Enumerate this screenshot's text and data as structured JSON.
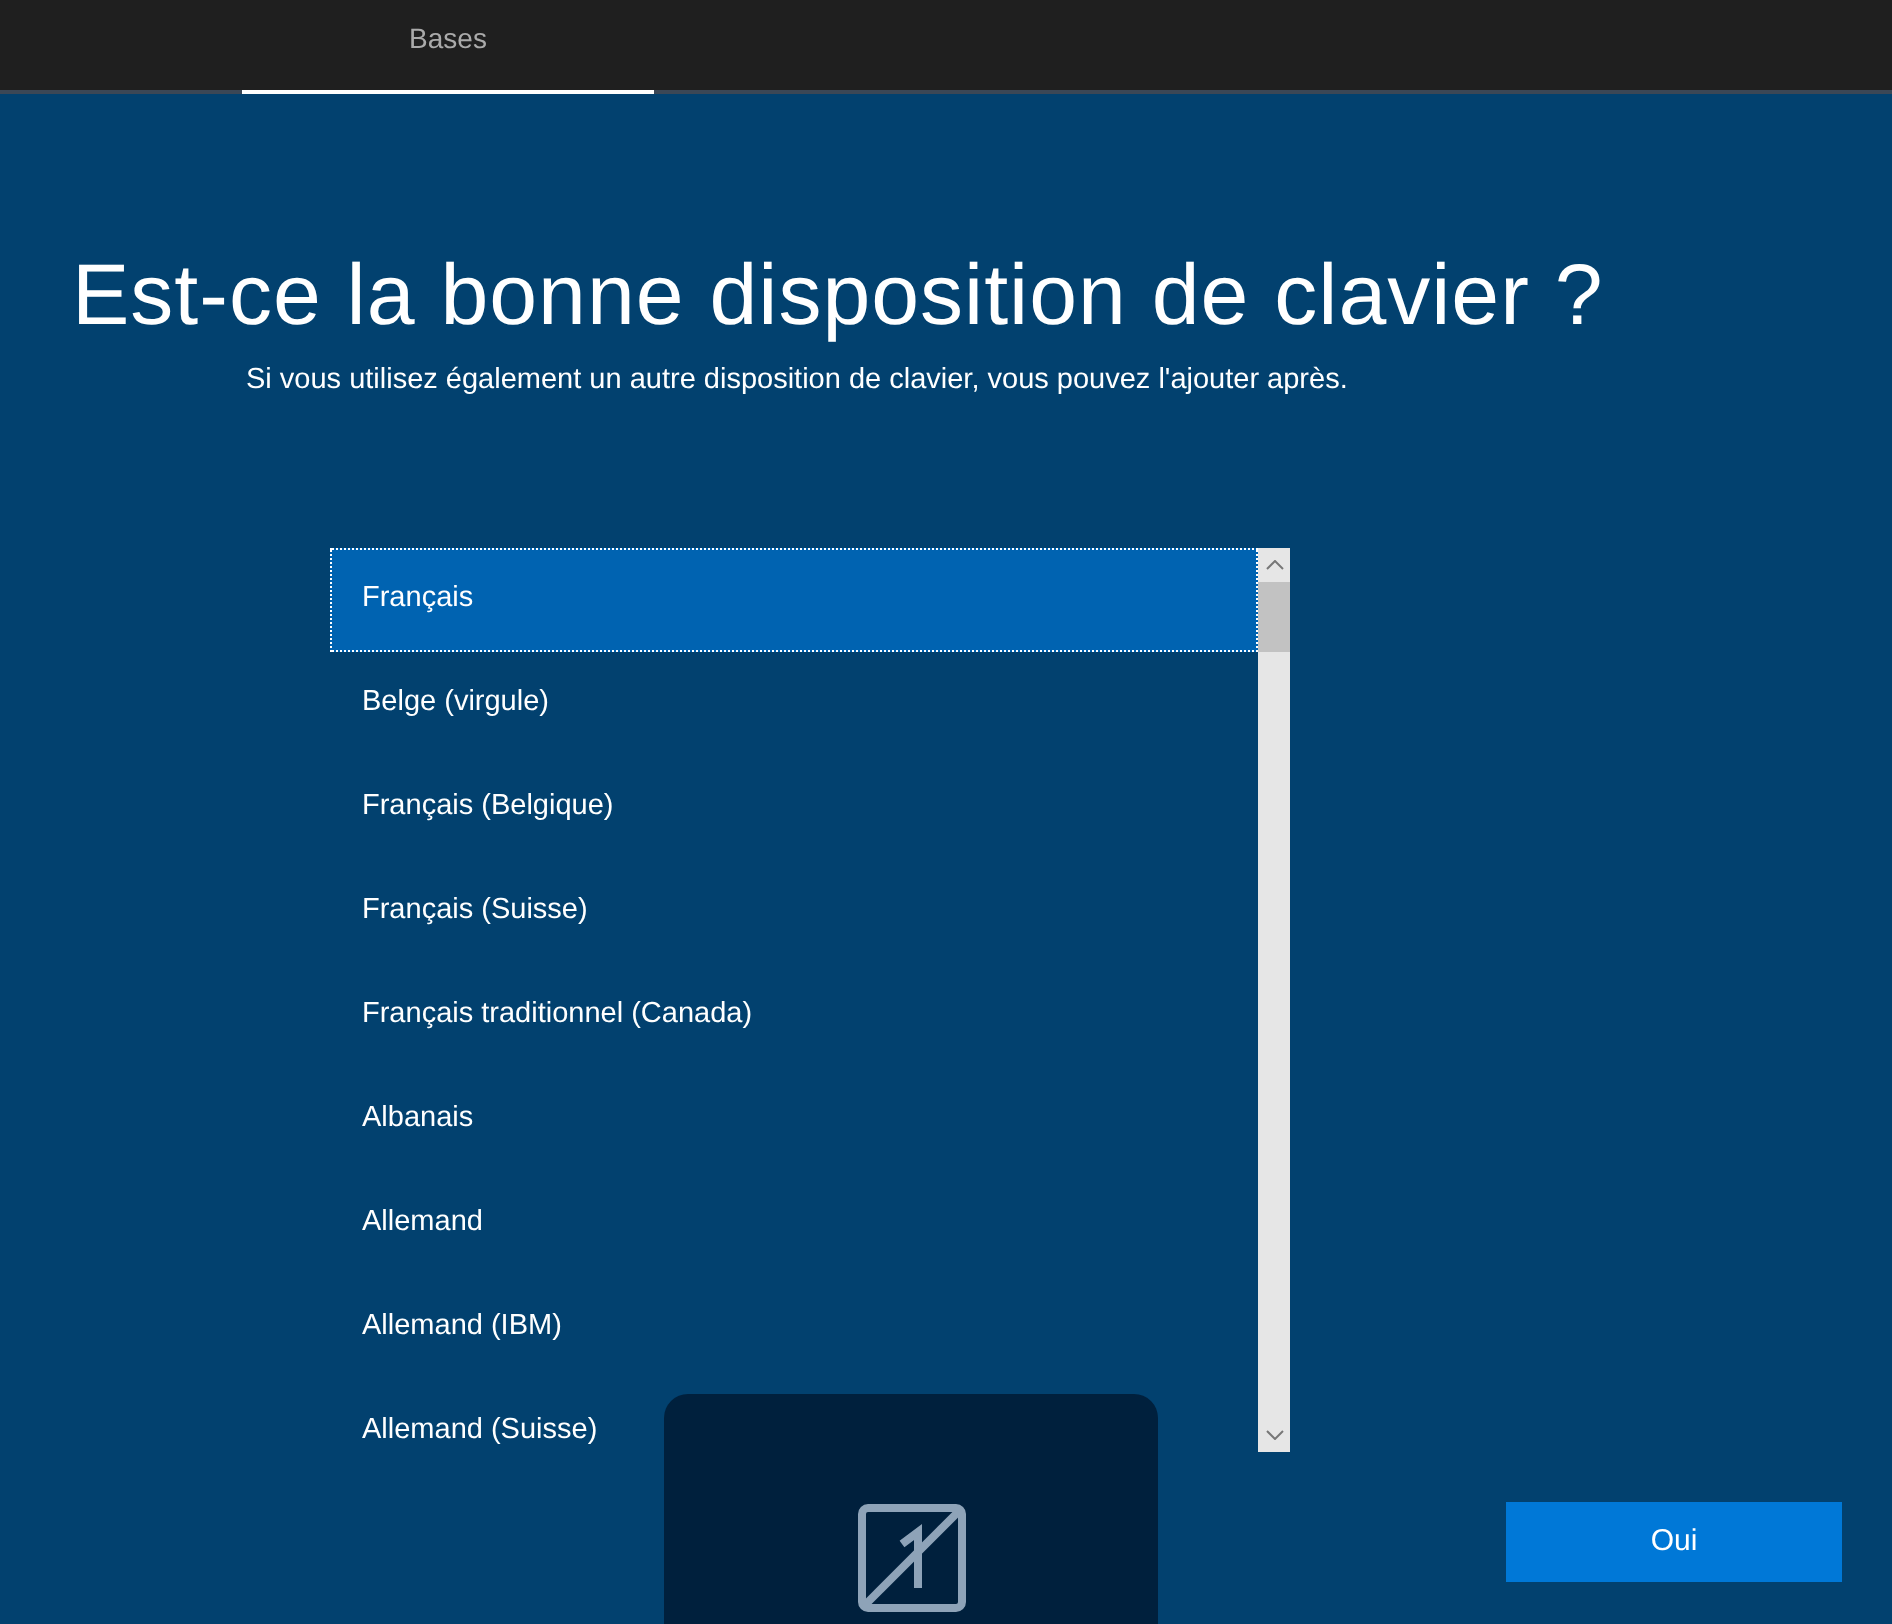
{
  "tabs": [
    {
      "label": "Bases",
      "selected": true
    }
  ],
  "heading": "Est-ce la bonne disposition de clavier ?",
  "subtitle": "Si vous utilisez également un autre disposition de clavier, vous pouvez l'ajouter après.",
  "layouts": [
    {
      "label": "Français",
      "selected": true
    },
    {
      "label": "Belge (virgule)",
      "selected": false
    },
    {
      "label": "Français (Belgique)",
      "selected": false
    },
    {
      "label": "Français (Suisse)",
      "selected": false
    },
    {
      "label": "Français traditionnel (Canada)",
      "selected": false
    },
    {
      "label": "Albanais",
      "selected": false
    },
    {
      "label": "Allemand",
      "selected": false
    },
    {
      "label": "Allemand (IBM)",
      "selected": false
    },
    {
      "label": "Allemand (Suisse)",
      "selected": false
    }
  ],
  "buttons": [
    "Oui"
  ]
}
